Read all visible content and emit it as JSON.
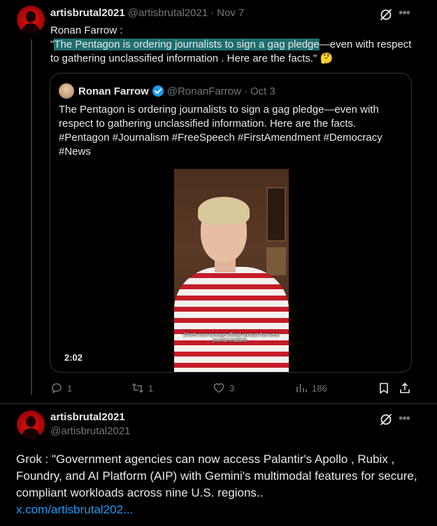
{
  "post1": {
    "display_name": "artisbrutal2021",
    "handle": "@artisbrutal2021",
    "separator": "·",
    "date": "Nov 7",
    "text_line1": "Ronan Farrow :",
    "text_quote_open": "\"",
    "text_highlight": "The Pentagon is ordering journalists to sign a gag pledge",
    "text_rest": "—even with respect to gathering unclassified information .  Here are the facts.\" 🤔",
    "quote": {
      "display_name": "Ronan Farrow",
      "handle": "@RonanFarrow",
      "separator": "·",
      "date": "Oct 3",
      "text": "The Pentagon is ordering journalists to sign a gag pledge—even with respect to gathering unclassified information. Here are the facts. #Pentagon #Journalism #FreeSpeech #FirstAmendment #Democracy #News",
      "video_duration": "2:02",
      "video_caption": "Chiefs now arrange official contact that wear journal enabled..."
    },
    "actions": {
      "replies": "1",
      "reposts": "1",
      "likes": "3",
      "views": "186"
    }
  },
  "post2": {
    "display_name": "artisbrutal2021",
    "handle": "@artisbrutal2021",
    "text": "Grok : \"Government agencies can now access Palantir's Apollo , Rubix , Foundry, and AI Platform (AIP) with Gemini's multimodal features for secure, compliant workloads across nine U.S. regions..",
    "link": "x.com/artisbrutal202..."
  },
  "colors": {
    "background": "#000000",
    "text_primary": "#e7e9ea",
    "text_secondary": "#71767b",
    "link": "#1d9bf0",
    "verified": "#1d9bf0",
    "highlight": "#1f6f6f"
  }
}
